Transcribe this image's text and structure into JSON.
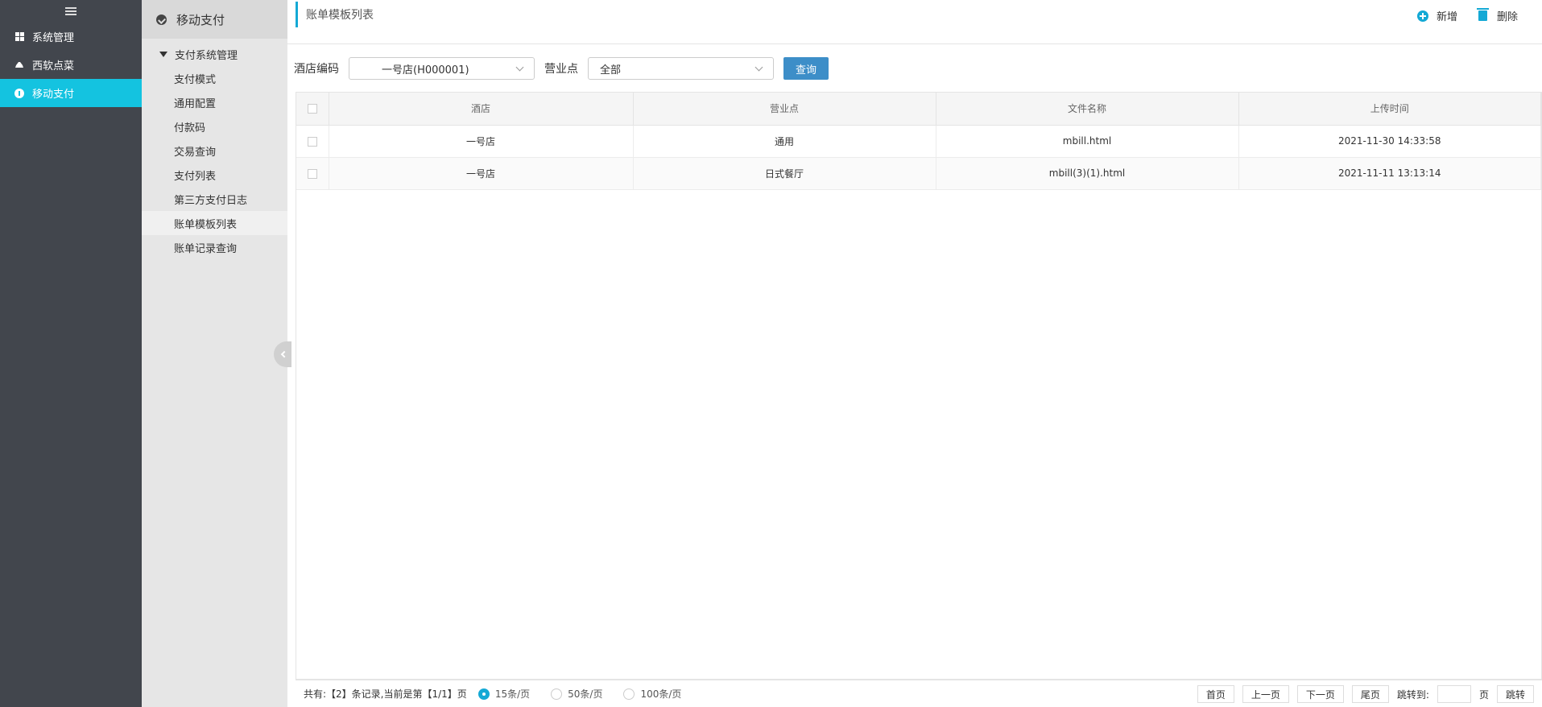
{
  "nav": {
    "items": [
      {
        "label": "系统管理",
        "icon": "grid-icon",
        "active": false
      },
      {
        "label": "西软点菜",
        "icon": "cloud-icon",
        "active": false
      },
      {
        "label": "移动支付",
        "icon": "coin-icon",
        "active": true
      }
    ]
  },
  "sub": {
    "title": "移动支付",
    "group": "支付系统管理",
    "items": [
      {
        "label": "支付模式"
      },
      {
        "label": "通用配置"
      },
      {
        "label": "付款码"
      },
      {
        "label": "交易查询"
      },
      {
        "label": "支付列表"
      },
      {
        "label": "第三方支付日志"
      },
      {
        "label": "账单模板列表",
        "active": true
      },
      {
        "label": "账单记录查询"
      }
    ]
  },
  "header": {
    "title": "账单模板列表",
    "add_label": "新增",
    "delete_label": "删除"
  },
  "filters": {
    "hotel_label": "酒店编码",
    "hotel_value": "一号店(H000001)",
    "outlet_label": "营业点",
    "outlet_value": "全部",
    "query_label": "查询"
  },
  "table": {
    "columns": [
      "酒店",
      "营业点",
      "文件名称",
      "上传时间"
    ],
    "rows": [
      {
        "hotel": "一号店",
        "outlet": "通用",
        "file": "mbill.html",
        "time": "2021-11-30 14:33:58"
      },
      {
        "hotel": "一号店",
        "outlet": "日式餐厅",
        "file": "mbill(3)(1).html",
        "time": "2021-11-11 13:13:14"
      }
    ]
  },
  "footer": {
    "summary": "共有:【2】条记录,当前是第【1/1】页",
    "page_sizes": [
      "15条/页",
      "50条/页",
      "100条/页"
    ],
    "first": "首页",
    "prev": "上一页",
    "next": "下一页",
    "last": "尾页",
    "jump_label": "跳转到:",
    "page_unit": "页",
    "jump_btn": "跳转"
  },
  "colors": {
    "nav_bg": "#42464d",
    "nav_active": "#14c3e0",
    "accent": "#14a9d5",
    "query_button": "#3d8ec8"
  }
}
